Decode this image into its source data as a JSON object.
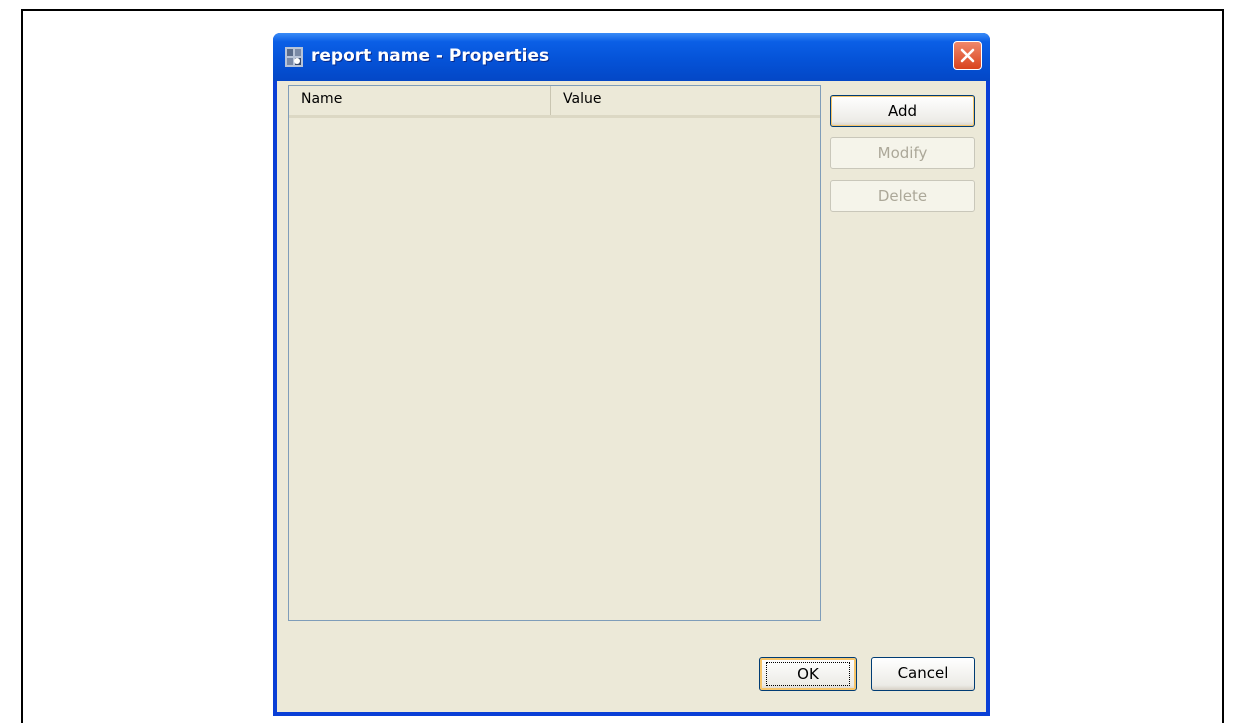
{
  "window": {
    "title": "report name - Properties"
  },
  "table": {
    "columns": [
      "Name",
      "Value"
    ],
    "rows": []
  },
  "buttons": {
    "add": "Add",
    "modify": "Modify",
    "delete": "Delete",
    "ok": "OK",
    "cancel": "Cancel"
  },
  "colors": {
    "titlebar": "#0553d8",
    "client_background": "#ece9d8",
    "close_button": "#d9431e"
  },
  "icons": {
    "app": "properties-app-icon",
    "close": "close-icon"
  }
}
